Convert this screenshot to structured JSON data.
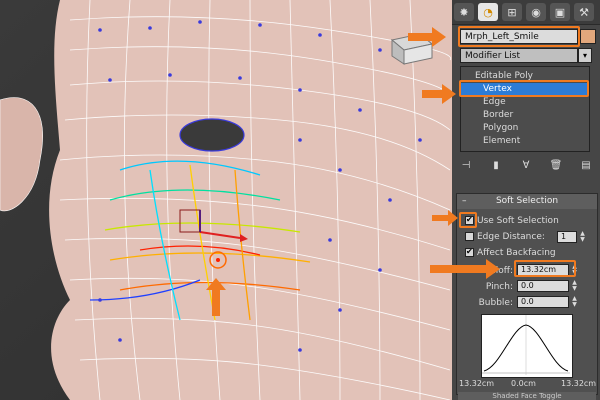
{
  "panel": {
    "tabs": [
      "create-icon",
      "modify-icon",
      "hierarchy-icon",
      "motion-icon",
      "display-icon",
      "utilities-icon"
    ],
    "object_name": "Mrph_Left_Smile",
    "modifier_list": "Modifier List",
    "dropdown_arrow": "▾",
    "stack": {
      "root": "Editable Poly",
      "items": [
        "Vertex",
        "Edge",
        "Border",
        "Polygon",
        "Element"
      ]
    }
  },
  "soft_selection": {
    "title": "Soft Selection",
    "collapse_glyph": "–",
    "use_soft_selection": "Use Soft Selection",
    "edge_distance": "Edge Distance:",
    "edge_distance_value": "1",
    "affect_backfacing": "Affect Backfacing",
    "falloff_label": "Falloff:",
    "falloff_value": "13.32cm",
    "pinch_label": "Pinch:",
    "pinch_value": "0.0",
    "bubble_label": "Bubble:",
    "bubble_value": "0.0",
    "curve_left": "13.32cm",
    "curve_center": "0.0cm",
    "curve_right": "13.32cm",
    "footer": "Shaded Face Toggle"
  },
  "colors": {
    "highlight": "#f07a20",
    "selected": "#2d7cd6",
    "wire": "#ffffff",
    "vertex": "#3a3adc"
  }
}
